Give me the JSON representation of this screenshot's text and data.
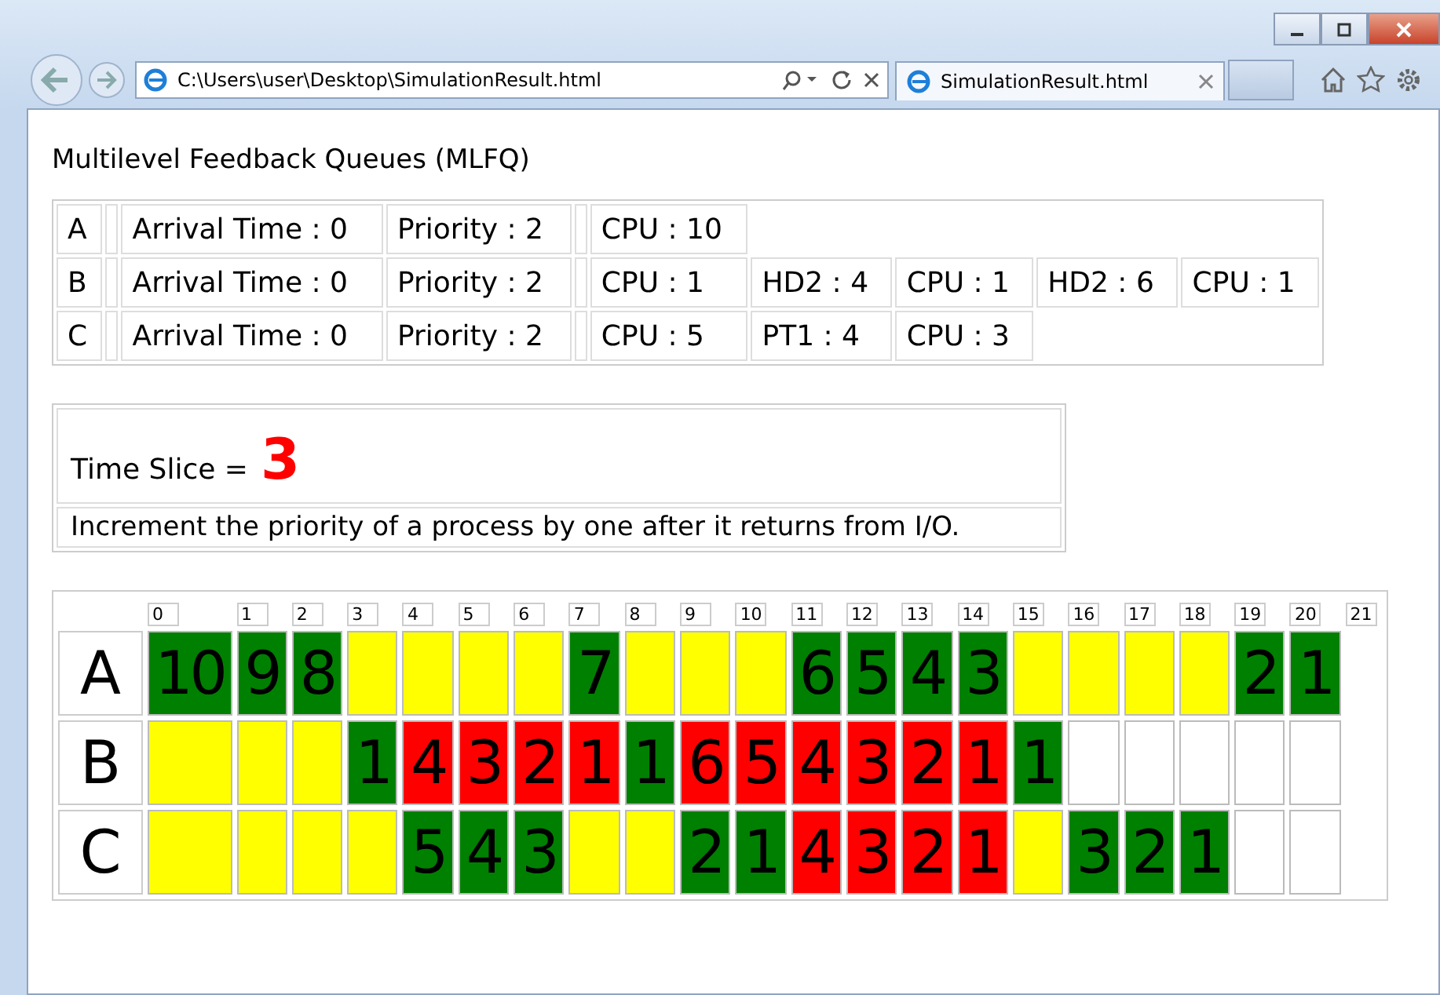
{
  "browser": {
    "address": "C:\\Users\\user\\Desktop\\SimulationResult.html",
    "tab_title": "SimulationResult.html"
  },
  "heading": "Multilevel Feedback Queues (MLFQ)",
  "processes": [
    {
      "name": "A",
      "arrival": "Arrival Time : 0",
      "priority": "Priority : 2",
      "bursts": [
        "CPU : 10"
      ]
    },
    {
      "name": "B",
      "arrival": "Arrival Time : 0",
      "priority": "Priority : 2",
      "bursts": [
        "CPU : 1",
        "HD2 : 4",
        "CPU : 1",
        "HD2 : 6",
        "CPU : 1"
      ]
    },
    {
      "name": "C",
      "arrival": "Arrival Time : 0",
      "priority": "Priority : 2",
      "bursts": [
        "CPU : 5",
        "PT1 : 4",
        "CPU : 3"
      ]
    }
  ],
  "time_slice": {
    "label": "Time Slice =",
    "value": "3"
  },
  "rule": "Increment the priority of a process by one after it returns from I/O.",
  "gantt": {
    "ticks": [
      "0",
      "1",
      "2",
      "3",
      "4",
      "5",
      "6",
      "7",
      "8",
      "9",
      "10",
      "11",
      "12",
      "13",
      "14",
      "15",
      "16",
      "17",
      "18",
      "19",
      "20",
      "21"
    ],
    "rows": [
      {
        "name": "A",
        "cells": [
          {
            "color": "#008000",
            "text": "10"
          },
          {
            "color": "#008000",
            "text": "9"
          },
          {
            "color": "#008000",
            "text": "8"
          },
          {
            "color": "#ffff00"
          },
          {
            "color": "#ffff00"
          },
          {
            "color": "#ffff00"
          },
          {
            "color": "#ffff00"
          },
          {
            "color": "#008000",
            "text": "7"
          },
          {
            "color": "#ffff00"
          },
          {
            "color": "#ffff00"
          },
          {
            "color": "#ffff00"
          },
          {
            "color": "#008000",
            "text": "6"
          },
          {
            "color": "#008000",
            "text": "5"
          },
          {
            "color": "#008000",
            "text": "4"
          },
          {
            "color": "#008000",
            "text": "3"
          },
          {
            "color": "#ffff00"
          },
          {
            "color": "#ffff00"
          },
          {
            "color": "#ffff00"
          },
          {
            "color": "#ffff00"
          },
          {
            "color": "#008000",
            "text": "2"
          },
          {
            "color": "#008000",
            "text": "1"
          }
        ]
      },
      {
        "name": "B",
        "cells": [
          {
            "color": "#ffff00"
          },
          {
            "color": "#ffff00"
          },
          {
            "color": "#ffff00"
          },
          {
            "color": "#008000",
            "text": "1"
          },
          {
            "color": "#ff0000",
            "text": "4"
          },
          {
            "color": "#ff0000",
            "text": "3"
          },
          {
            "color": "#ff0000",
            "text": "2"
          },
          {
            "color": "#ff0000",
            "text": "1"
          },
          {
            "color": "#008000",
            "text": "1"
          },
          {
            "color": "#ff0000",
            "text": "6"
          },
          {
            "color": "#ff0000",
            "text": "5"
          },
          {
            "color": "#ff0000",
            "text": "4"
          },
          {
            "color": "#ff0000",
            "text": "3"
          },
          {
            "color": "#ff0000",
            "text": "2"
          },
          {
            "color": "#ff0000",
            "text": "1"
          },
          {
            "color": "#008000",
            "text": "1"
          },
          {
            "color": "#ffffff"
          },
          {
            "color": "#ffffff"
          },
          {
            "color": "#ffffff"
          },
          {
            "color": "#ffffff"
          },
          {
            "color": "#ffffff"
          }
        ]
      },
      {
        "name": "C",
        "cells": [
          {
            "color": "#ffff00"
          },
          {
            "color": "#ffff00"
          },
          {
            "color": "#ffff00"
          },
          {
            "color": "#ffff00"
          },
          {
            "color": "#008000",
            "text": "5"
          },
          {
            "color": "#008000",
            "text": "4"
          },
          {
            "color": "#008000",
            "text": "3"
          },
          {
            "color": "#ffff00"
          },
          {
            "color": "#ffff00"
          },
          {
            "color": "#008000",
            "text": "2"
          },
          {
            "color": "#008000",
            "text": "1"
          },
          {
            "color": "#ff0000",
            "text": "4"
          },
          {
            "color": "#ff0000",
            "text": "3"
          },
          {
            "color": "#ff0000",
            "text": "2"
          },
          {
            "color": "#ff0000",
            "text": "1"
          },
          {
            "color": "#ffff00"
          },
          {
            "color": "#008000",
            "text": "3"
          },
          {
            "color": "#008000",
            "text": "2"
          },
          {
            "color": "#008000",
            "text": "1"
          },
          {
            "color": "#ffffff"
          },
          {
            "color": "#ffffff"
          }
        ]
      }
    ]
  }
}
